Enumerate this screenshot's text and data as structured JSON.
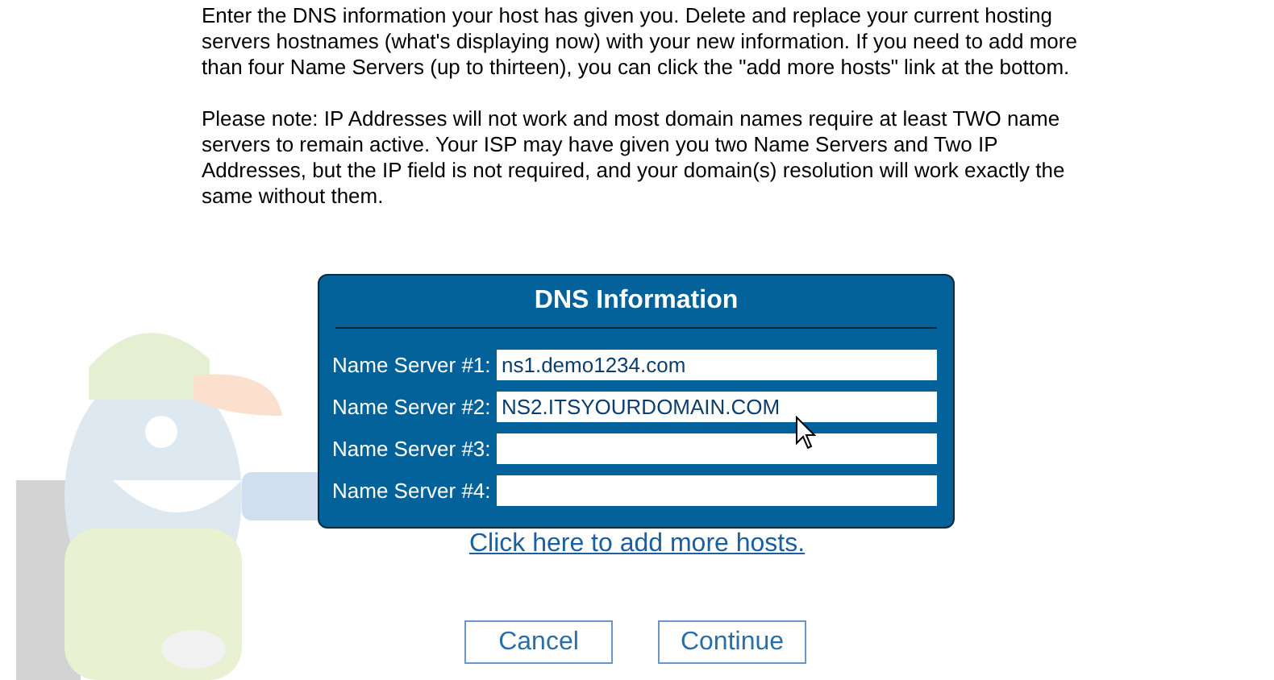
{
  "intro": [
    "Enter the DNS information your host has given you. Delete and replace your current hosting servers hostnames (what's displaying now) with your new information. If you need to add more than four Name Servers (up to thirteen), you can click the \"add more hosts\" link at the bottom.",
    "Please note: IP Addresses will not work and most domain names require at least TWO name servers to remain active. Your ISP may have given you two Name Servers and Two IP Addresses, but the IP field is not required, and your domain(s) resolution will work exactly the same without them."
  ],
  "dns_panel": {
    "title": "DNS Information",
    "fields": [
      {
        "label": "Name Server #1:",
        "value": "ns1.demo1234.com"
      },
      {
        "label": "Name Server #2:",
        "value": "NS2.ITSYOURDOMAIN.COM"
      },
      {
        "label": "Name Server #3:"
      },
      {
        "label": "Name Server #4:"
      }
    ]
  },
  "add_link": "Click here to add more hosts.",
  "buttons": [
    "Cancel",
    "Continue"
  ]
}
